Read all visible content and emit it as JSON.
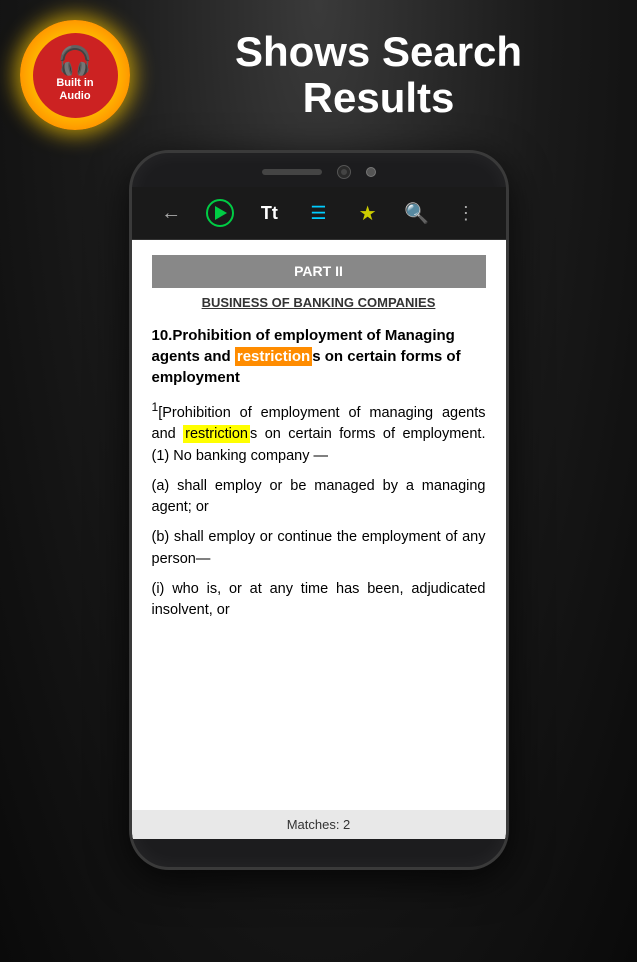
{
  "header": {
    "title_line1": "Shows Search",
    "title_line2": "Results",
    "badge": {
      "line1": "Built in",
      "line2": "Audio"
    }
  },
  "toolbar": {
    "back_label": "←",
    "play_label": "▶",
    "text_size_label": "Tt",
    "toc_label": "≡",
    "bookmark_label": "★",
    "search_label": "⌕",
    "more_label": "⋮"
  },
  "document": {
    "part_header": "PART II",
    "subtitle": "BUSINESS OF BANKING COMPANIES",
    "heading": "10. Prohibition of employment of Managing agents and restrictions on certain forms of employment",
    "heading_highlight": "restrictions",
    "paragraph1": "[Prohibition of employment of managing agents and restrictions on certain forms of employment. (1) No banking company —",
    "paragraph1_superscript": "1",
    "paragraph1_highlight": "restrictions",
    "para_a": "(a) shall employ or be managed by a managing agent; or",
    "para_b": "(b) shall employ or continue the employment of any person—",
    "para_i": "(i) who is, or at any time has been, adjudicated insolvent, or",
    "matches_text": "Matches: 2"
  },
  "colors": {
    "highlight_orange": "#ff8c00",
    "highlight_yellow": "#ffff00",
    "accent_green": "#00cc44",
    "accent_cyan": "#00ccff",
    "toolbar_bg": "#1a1a1a",
    "doc_bg": "#ffffff"
  }
}
